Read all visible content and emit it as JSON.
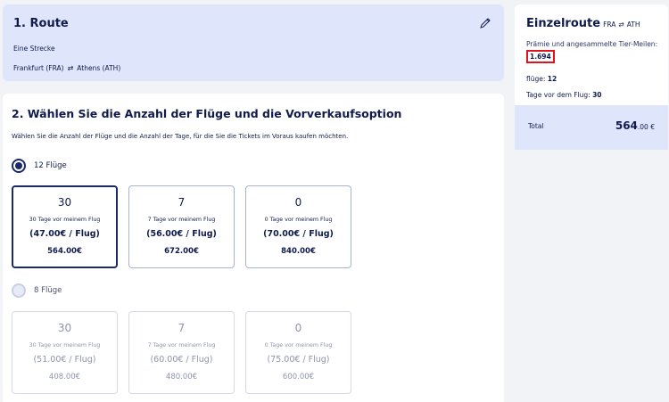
{
  "route": {
    "title": "1. Route",
    "type": "Eine Strecke",
    "from": "Frankfurt (FRA)",
    "swap_symbol": "⇄",
    "to": "Athens (ATH)"
  },
  "selection": {
    "title": "2. Wählen Sie die Anzahl der Flüge und die Vorverkaufsoption",
    "subtitle": "Wählen Sie die Anzahl der Flüge und die Anzahl der Tage, für die Sie die Tickets im Voraus kaufen möchten.",
    "groups": [
      {
        "label": "12 Flüge",
        "selected": true,
        "options": [
          {
            "days": "30",
            "days_label": "30 Tage vor meinem Flug",
            "per_flight": "(47.00€ / Flug)",
            "price": "564.00€"
          },
          {
            "days": "7",
            "days_label": "7 Tage vor meinem Flug",
            "per_flight": "(56.00€ / Flug)",
            "price": "672.00€"
          },
          {
            "days": "0",
            "days_label": "0 Tage vor meinem Flug",
            "per_flight": "(70.00€ / Flug)",
            "price": "840.00€"
          }
        ]
      },
      {
        "label": "8 Flüge",
        "selected": false,
        "options": [
          {
            "days": "30",
            "days_label": "30 Tage vor meinem Flug",
            "per_flight": "(51.00€ / Flug)",
            "price": "408.00€"
          },
          {
            "days": "7",
            "days_label": "7 Tage vor meinem Flug",
            "per_flight": "(60.00€ / Flug)",
            "price": "480.00€"
          },
          {
            "days": "0",
            "days_label": "0 Tage vor meinem Flug",
            "per_flight": "(75.00€ / Flug)",
            "price": "600.00€"
          }
        ]
      }
    ]
  },
  "summary": {
    "title": "Einzelroute",
    "from_code": "FRA",
    "swap_symbol": "⇄",
    "to_code": "ATH",
    "miles_label": "Prämie und angesammelte Tier-Meilen:",
    "miles_value": "1.694",
    "flights_label": "flüge:",
    "flights_value": "12",
    "days_label": "Tage vor dem Flug:",
    "days_value": "30",
    "total_label": "Total",
    "total_main": "564",
    "total_cents": ".00 €"
  },
  "colors": {
    "navy": "#0f1b4c",
    "panel_blue": "#dfe5fb",
    "highlight_red": "#e0141e"
  }
}
